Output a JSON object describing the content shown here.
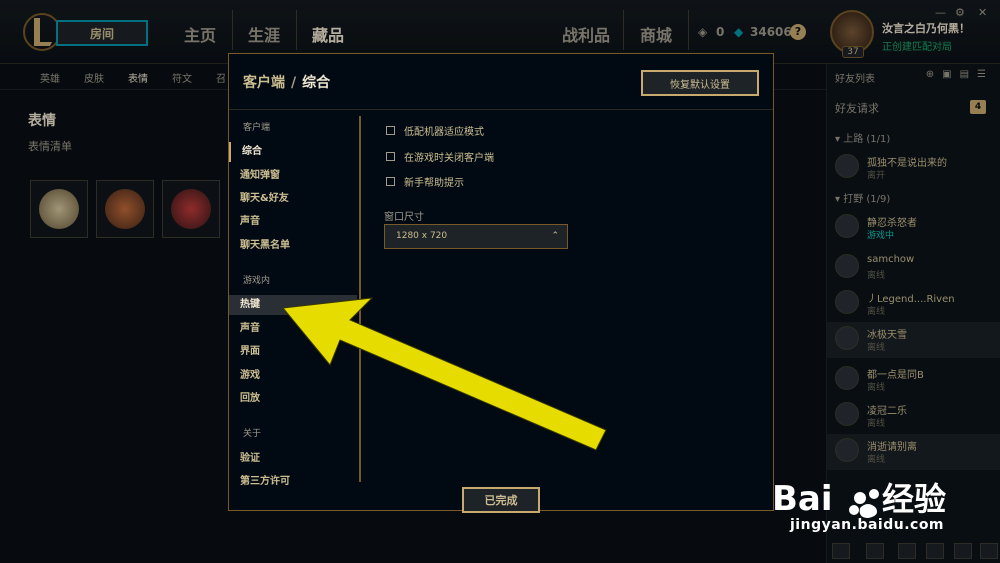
{
  "topbar": {
    "room_label": "房间",
    "nav": [
      "主页",
      "生涯",
      "藏品",
      "战利品",
      "商城"
    ],
    "active_nav": "藏品",
    "rp": "0",
    "be": "34606",
    "help": "?",
    "player": {
      "name": "汝言之白乃何黑！",
      "status": "正创建匹配对局",
      "level": "37"
    },
    "window_controls": [
      "—",
      "⚙",
      "✕"
    ]
  },
  "subnav": {
    "items": [
      "英雄",
      "皮肤",
      "表情",
      "符文",
      "召"
    ],
    "active": "表情"
  },
  "collection": {
    "title": "表情",
    "subtitle": "表情清单",
    "emotes": [
      "emote-1",
      "emote-2",
      "emote-3"
    ]
  },
  "friends": {
    "title": "好友列表",
    "requests_label": "好友请求",
    "requests_count": "4",
    "groups": [
      {
        "label": "▾ 上路 (1/1)"
      },
      {
        "label": "▾ 打野 (1/9)"
      }
    ],
    "rows": [
      {
        "name": "孤独不是说出来的",
        "status": "离开",
        "ingame": false
      },
      {
        "name": "静忍杀怒者",
        "status": "游戏中",
        "ingame": true
      },
      {
        "name": "samchow",
        "status": "离线",
        "ingame": false
      },
      {
        "name": "丿Legend....Riven",
        "status": "离线",
        "ingame": false
      },
      {
        "name": "冰极天雪",
        "status": "离线",
        "ingame": false
      },
      {
        "name": "都一点是同B",
        "status": "离线",
        "ingame": false
      },
      {
        "name": "凌冠二乐",
        "status": "离线",
        "ingame": false
      },
      {
        "name": "消逝请别离",
        "status": "离线",
        "ingame": false
      }
    ]
  },
  "modal": {
    "crumb_parent": "客户端",
    "crumb_current": "综合",
    "reset_label": "恢复默认设置",
    "done_label": "已完成",
    "categories": {
      "client": "客户端",
      "ingame": "游戏内",
      "about": "关于"
    },
    "client_items": [
      "综合",
      "通知弹窗",
      "聊天&好友",
      "声音",
      "聊天黑名单"
    ],
    "ingame_items": [
      "热键",
      "声音",
      "界面",
      "游戏",
      "回放"
    ],
    "about_items": [
      "验证",
      "第三方许可"
    ],
    "options": [
      "低配机器适应模式",
      "在游戏时关闭客户端",
      "新手帮助提示"
    ],
    "window_size_label": "窗口尺寸",
    "window_size_value": "1280 x 720"
  },
  "watermark": {
    "url": "jingyan.baidu.com"
  },
  "colors": {
    "gold": "#c8aa6e",
    "teal": "#0596aa",
    "arrow": "#e6dc00"
  }
}
